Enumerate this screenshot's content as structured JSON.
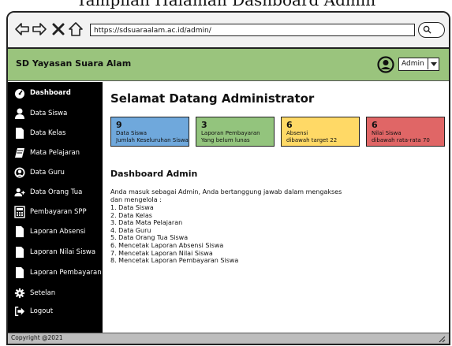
{
  "caption": "Tampilan Halaman Dashboard Admin",
  "browser": {
    "url": "https://sdsuaraalam.ac.id/admin/",
    "icons": [
      "back-arrow-icon",
      "forward-arrow-icon",
      "close-icon",
      "home-icon",
      "search-icon"
    ]
  },
  "header": {
    "school_name": "SD Yayasan Suara Alam",
    "user_label": "Admin"
  },
  "sidebar": {
    "items": [
      {
        "label": "Dashboard",
        "icon": "dashboard-icon"
      },
      {
        "label": "Data Siswa",
        "icon": "user-icon"
      },
      {
        "label": "Data Kelas",
        "icon": "document-icon"
      },
      {
        "label": "Mata Pelajaran",
        "icon": "book-icon"
      },
      {
        "label": "Data Guru",
        "icon": "user-circle-icon"
      },
      {
        "label": "Data Orang Tua",
        "icon": "add-user-icon"
      },
      {
        "label": "Pembayaran SPP",
        "icon": "calculator-icon"
      },
      {
        "label": "Laporan Absensi",
        "icon": "document-icon"
      },
      {
        "label": "Laporan Nilai Siswa",
        "icon": "document-icon"
      },
      {
        "label": "Laporan Pembayaran",
        "icon": "document-icon"
      },
      {
        "label": "Setelan",
        "icon": "gear-icon"
      },
      {
        "label": "Logout",
        "icon": "logout-icon"
      }
    ]
  },
  "main": {
    "welcome": "Selamat Datang Administrator",
    "cards": [
      {
        "number": "9",
        "line1": "Data Siswa",
        "line2": "Jumlah Keseluruhan Siswa",
        "color": "#6fa8dc"
      },
      {
        "number": "3",
        "line1": "Laporan Pembayaran",
        "line2": "Yang belum lunas",
        "color": "#93c47d"
      },
      {
        "number": "6",
        "line1": "Absensi",
        "line2": "dibawah target 22",
        "color": "#ffd966"
      },
      {
        "number": "6",
        "line1": "Nilai Siswa",
        "line2": "dibawah rata-rata 70",
        "color": "#e06666"
      }
    ],
    "section_title": "Dashboard Admin",
    "intro": "Anda masuk sebagai Admin, Anda bertanggung jawab dalam mengakses dan mengelola :",
    "list": [
      "1. Data Siswa",
      "2. Data Kelas",
      "3. Data Mata Pelajaran",
      "4. Data Guru",
      "5. Data Orang Tua Siswa",
      "6. Mencetak Laporan Absensi Siswa",
      "7. Mencetak Laporan Nilai Siswa",
      "8. Mencetak Laporan Pembayaran Siswa"
    ]
  },
  "footer": {
    "copyright": "Copyright @2021"
  }
}
